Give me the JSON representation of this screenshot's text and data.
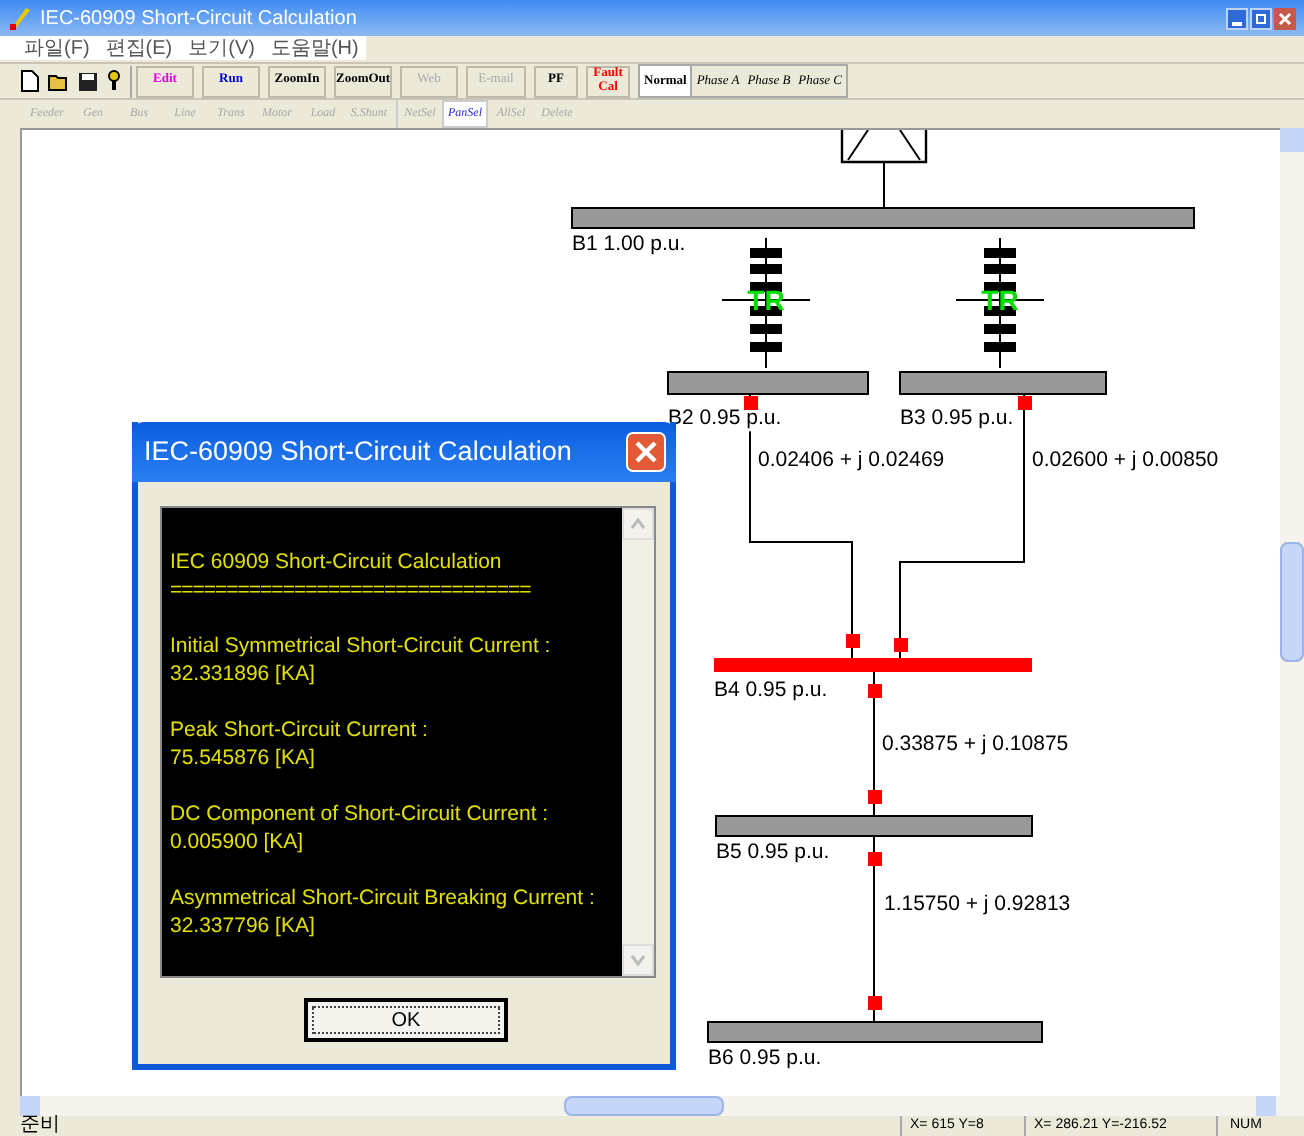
{
  "window": {
    "title": "IEC-60909 Short-Circuit Calculation"
  },
  "menu": [
    "파일(F)",
    "편집(E)",
    "보기(V)",
    "도움말(H)"
  ],
  "actions": [
    {
      "label": "Edit",
      "color": "#e000e0",
      "disabled": false
    },
    {
      "label": "Run",
      "color": "#0000c8",
      "disabled": false
    },
    {
      "label": "ZoomIn",
      "color": "#000000",
      "disabled": false
    },
    {
      "label": "ZoomOut",
      "color": "#000000",
      "disabled": false
    },
    {
      "label": "Web",
      "color": "#a8a8a8",
      "disabled": true
    },
    {
      "label": "E-mail",
      "color": "#a8a8a8",
      "disabled": true
    },
    {
      "label": "PF",
      "color": "#000000",
      "disabled": false
    },
    {
      "label": "Fault Cal",
      "color": "#ff0000",
      "disabled": false
    }
  ],
  "phases": [
    {
      "label": "Normal",
      "selected": true
    },
    {
      "label": "Phase A",
      "selected": false
    },
    {
      "label": "Phase B",
      "selected": false
    },
    {
      "label": "Phase C",
      "selected": false
    }
  ],
  "tools": [
    {
      "label": "Feeder",
      "disabled": true,
      "selected": false
    },
    {
      "label": "Gen",
      "disabled": true,
      "selected": false
    },
    {
      "label": "Bus",
      "disabled": true,
      "selected": false
    },
    {
      "label": "Line",
      "disabled": true,
      "selected": false
    },
    {
      "label": "Trans",
      "disabled": true,
      "selected": false
    },
    {
      "label": "Motor",
      "disabled": true,
      "selected": false
    },
    {
      "label": "Load",
      "disabled": true,
      "selected": false
    },
    {
      "label": "S.Shunt",
      "disabled": true,
      "selected": false
    },
    {
      "label": "NetSel",
      "disabled": true,
      "selected": false
    },
    {
      "label": "PanSel",
      "disabled": false,
      "selected": true
    },
    {
      "label": "AllSel",
      "disabled": true,
      "selected": false
    },
    {
      "label": "Delete",
      "disabled": true,
      "selected": false
    }
  ],
  "diagram": {
    "buses": [
      {
        "name": "B1",
        "voltage": "1.00 p.u.",
        "faulted": false
      },
      {
        "name": "B2",
        "voltage": "0.95 p.u.",
        "faulted": false
      },
      {
        "name": "B3",
        "voltage": "0.95 p.u.",
        "faulted": false
      },
      {
        "name": "B4",
        "voltage": "0.95 p.u.",
        "faulted": true
      },
      {
        "name": "B5",
        "voltage": "0.95 p.u.",
        "faulted": false
      },
      {
        "name": "B6",
        "voltage": "0.95 p.u.",
        "faulted": false
      }
    ],
    "transformers": [
      {
        "label": "TR"
      },
      {
        "label": "TR"
      }
    ],
    "lines": [
      {
        "impedance": "0.02406 + j 0.02469"
      },
      {
        "impedance": "0.02600 + j 0.00850"
      },
      {
        "impedance": "0.33875 + j 0.10875"
      },
      {
        "impedance": "1.15750 + j 0.92813"
      }
    ]
  },
  "dialog": {
    "title": "IEC-60909 Short-Circuit Calculation",
    "heading": "IEC 60909 Short-Circuit Calculation",
    "rule": "================================",
    "results": [
      {
        "label": "Initial Symmetrical Short-Circuit Current :",
        "value": "32.331896 [KA]"
      },
      {
        "label": "Peak Short-Circuit Current :",
        "value": "75.545876 [KA]"
      },
      {
        "label": "DC Component of Short-Circuit Current :",
        "value": "0.005900 [KA]"
      },
      {
        "label": "Asymmetrical Short-Circuit Breaking Current :",
        "value": "32.337796 [KA]"
      }
    ],
    "button": "OK"
  },
  "status_bar": {
    "message": "준비",
    "cursor": "X= 615  Y=8",
    "coords": "X= 286.21  Y=-216.52",
    "num": "NUM"
  }
}
